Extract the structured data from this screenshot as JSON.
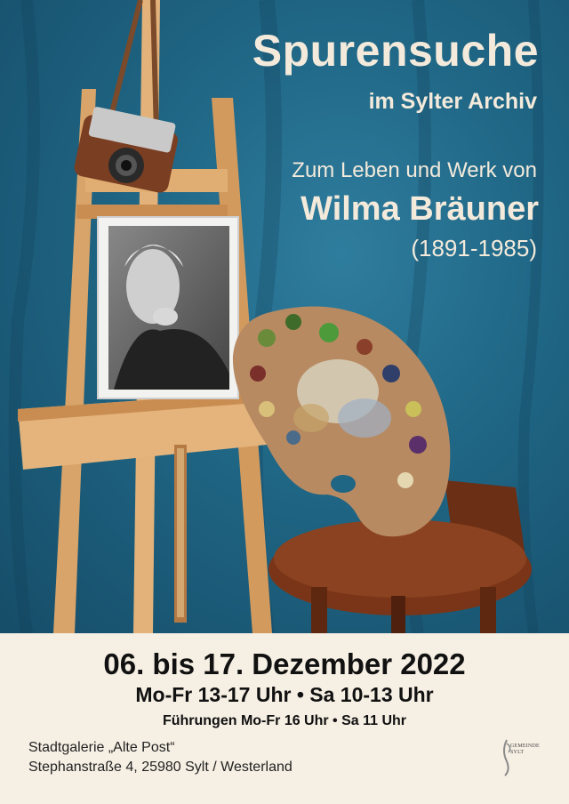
{
  "header": {
    "title": "Spurensuche",
    "subtitle": "im Sylter Archiv",
    "intro": "Zum Leben und Werk von",
    "artist": "Wilma Bräuner",
    "years": "(1891-1985)"
  },
  "photo": {
    "description_icon": "portrait-photo-icon"
  },
  "footer": {
    "dates": "06. bis 17. Dezember 2022",
    "hours": "Mo-Fr 13-17 Uhr • Sa 10-13 Uhr",
    "tours": "Führungen Mo-Fr 16 Uhr • Sa 11 Uhr",
    "venue": "Stadtgalerie „Alte Post“",
    "address": "Stephanstraße 4, 25980 Sylt / Westerland",
    "logo_line1": "GEMEINDE",
    "logo_line2": "SYLT"
  },
  "colors": {
    "background_blue": "#1f6584",
    "text_light": "#f3eadb",
    "footer_bg": "#f6efe4",
    "wood": "#d9a46a"
  }
}
